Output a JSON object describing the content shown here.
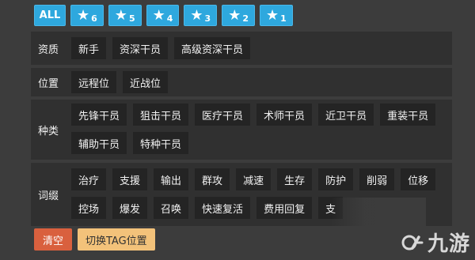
{
  "stars": {
    "all_label": "ALL",
    "buttons": [
      "6",
      "5",
      "4",
      "3",
      "2",
      "1"
    ]
  },
  "rows": {
    "qualification": {
      "label": "资质",
      "tags": [
        "新手",
        "资深干员",
        "高级资深干员"
      ]
    },
    "position": {
      "label": "位置",
      "tags": [
        "远程位",
        "近战位"
      ]
    },
    "class": {
      "label": "种类",
      "tags": [
        "先锋干员",
        "狙击干员",
        "医疗干员",
        "术师干员",
        "近卫干员",
        "重装干员",
        "辅助干员",
        "特种干员"
      ]
    },
    "affix": {
      "label": "词缀",
      "tags": [
        "治疗",
        "支援",
        "输出",
        "群攻",
        "减速",
        "生存",
        "防护",
        "削弱",
        "位移",
        "控场",
        "爆发",
        "召唤",
        "快速复活",
        "费用回复",
        "支"
      ]
    }
  },
  "actions": {
    "clear": "清空",
    "switch": "切换TAG位置"
  },
  "watermark": {
    "text": "九游"
  },
  "colors": {
    "background": "#3c3c3c",
    "panel": "#303030",
    "tag": "#242424",
    "star_button": "#2ea8de",
    "clear_button": "#d9603e",
    "switch_button": "#f3c27a"
  }
}
